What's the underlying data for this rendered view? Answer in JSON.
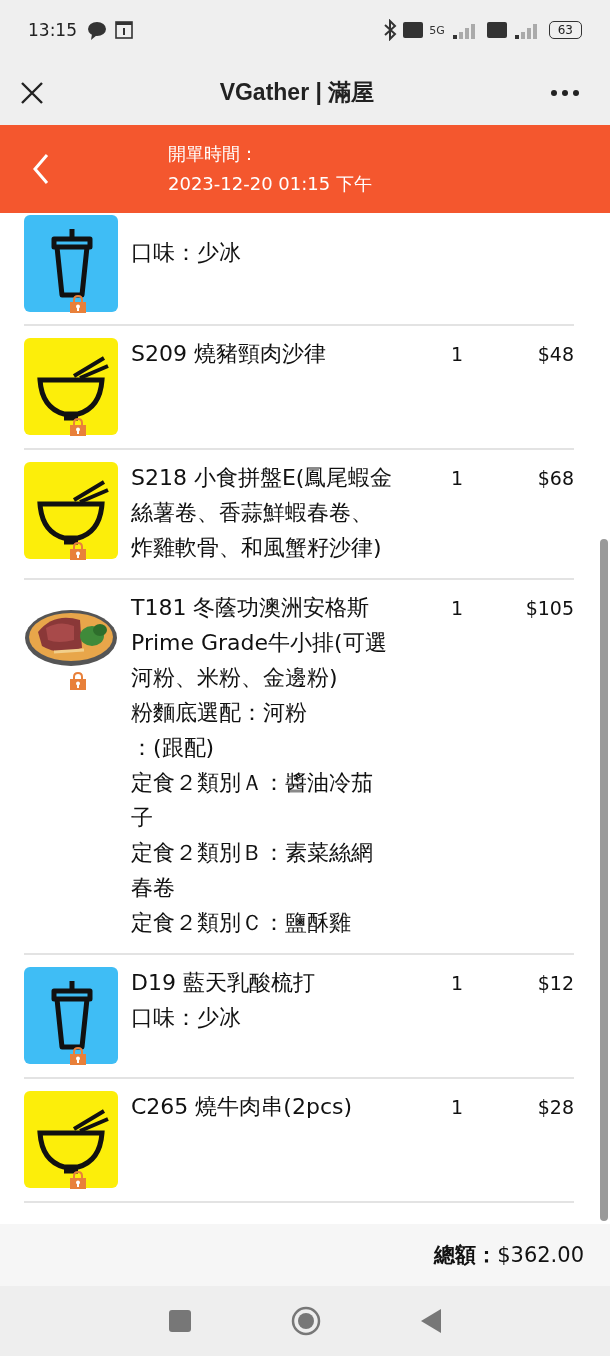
{
  "status_bar": {
    "time": "13:15",
    "network": "5G",
    "battery": "63"
  },
  "title_bar": {
    "title": "VGather | 滿屋"
  },
  "header": {
    "label": "開單時間：",
    "datetime": "2023-12-20 01:15 下午"
  },
  "items": [
    {
      "kind": "drink",
      "lines": [
        "口味：少冰"
      ],
      "cut": true
    },
    {
      "kind": "bowl",
      "name": "S209 燒豬頸肉沙律",
      "qty": "1",
      "price": "$48"
    },
    {
      "kind": "bowl",
      "name": "S218 小食拼盤E(鳳尾蝦金絲薯卷、香蒜鮮蝦春卷、炸雞軟骨、和風蟹籽沙律)",
      "qty": "1",
      "price": "$68"
    },
    {
      "name": "T181 冬蔭功澳洲安格斯Prime Grade牛小排(可選河粉、米粉、金邊粉)",
      "lines": [
        "粉麵底選配：河粉",
        "：(跟配)",
        "定食２類別Ａ：醬油冷茄子",
        "定食２類別Ｂ：素菜絲網春卷",
        "定食２類別Ｃ：鹽酥雞"
      ],
      "qty": "1",
      "price": "$105"
    },
    {
      "kind": "drink",
      "name": "D19 藍天乳酸梳打",
      "lines": [
        "口味：少冰"
      ],
      "qty": "1",
      "price": "$12"
    },
    {
      "kind": "bowl",
      "name": "C265 燒牛肉串(2pcs)",
      "qty": "1",
      "price": "$28"
    }
  ],
  "total": {
    "label": "總額：",
    "amount": "$362.00"
  }
}
